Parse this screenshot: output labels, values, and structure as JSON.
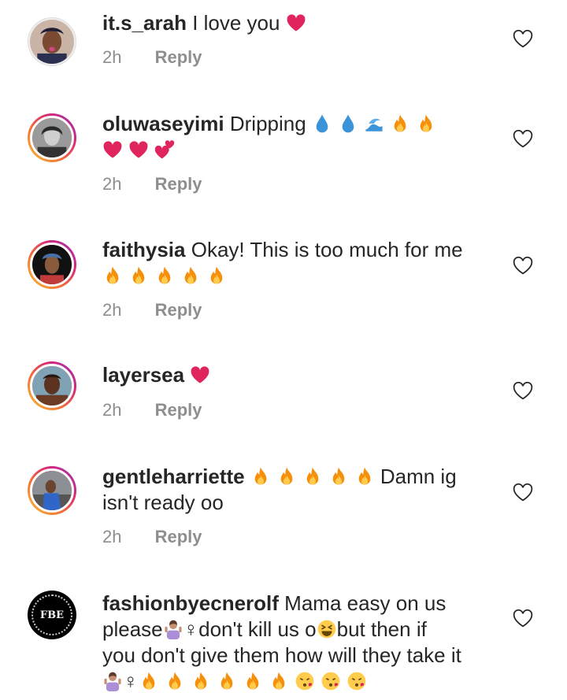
{
  "comments": [
    {
      "username": "it.s_arah",
      "text": "I love you",
      "time": "2h",
      "reply": "Reply",
      "emojis": [
        "pink-heart"
      ],
      "avatar": "profile-photo"
    },
    {
      "username": "oluwaseyimi",
      "text": "Dripping",
      "time": "2h",
      "reply": "Reply",
      "emojis": [
        "droplet",
        "droplet",
        "water-wave",
        "fire",
        "fire",
        "pink-heart",
        "pink-heart",
        "two-hearts"
      ],
      "avatar": "profile-photo"
    },
    {
      "username": "faithysia",
      "text": "Okay! This is too much for me",
      "time": "2h",
      "reply": "Reply",
      "emojis": [
        "fire",
        "fire",
        "fire",
        "fire",
        "fire"
      ],
      "avatar": "profile-photo"
    },
    {
      "username": "layersea",
      "text": "",
      "time": "2h",
      "reply": "Reply",
      "emojis": [
        "pink-heart"
      ],
      "avatar": "profile-photo"
    },
    {
      "username": "gentleharriette",
      "text_line1": "Damn ig",
      "text_line2": "isn't ready oo",
      "time": "2h",
      "reply": "Reply",
      "emojis": [
        "fire",
        "fire",
        "fire",
        "fire",
        "fire"
      ],
      "avatar": "profile-photo"
    },
    {
      "username": "fashionbyecnerolf",
      "text_part1": "Mama easy on us",
      "text_part2": "please",
      "text_part3": "♀don't kill us o",
      "text_part4": "but then if",
      "text_part5": "you don't give them how will they take it",
      "text_part6": "♀",
      "avatar_logo_text": "FBE",
      "emojis": [
        "person-gesturing-no",
        "grinning-squinting-face",
        "person-shrugging",
        "fire",
        "fire",
        "fire",
        "fire",
        "fire",
        "fire",
        "kissing-face",
        "kissing-face",
        "kissing-face"
      ]
    }
  ],
  "colors": {
    "username": "#262626",
    "meta": "#8e8e8e",
    "heart": "#e0245e",
    "fire": "#f4900c"
  }
}
